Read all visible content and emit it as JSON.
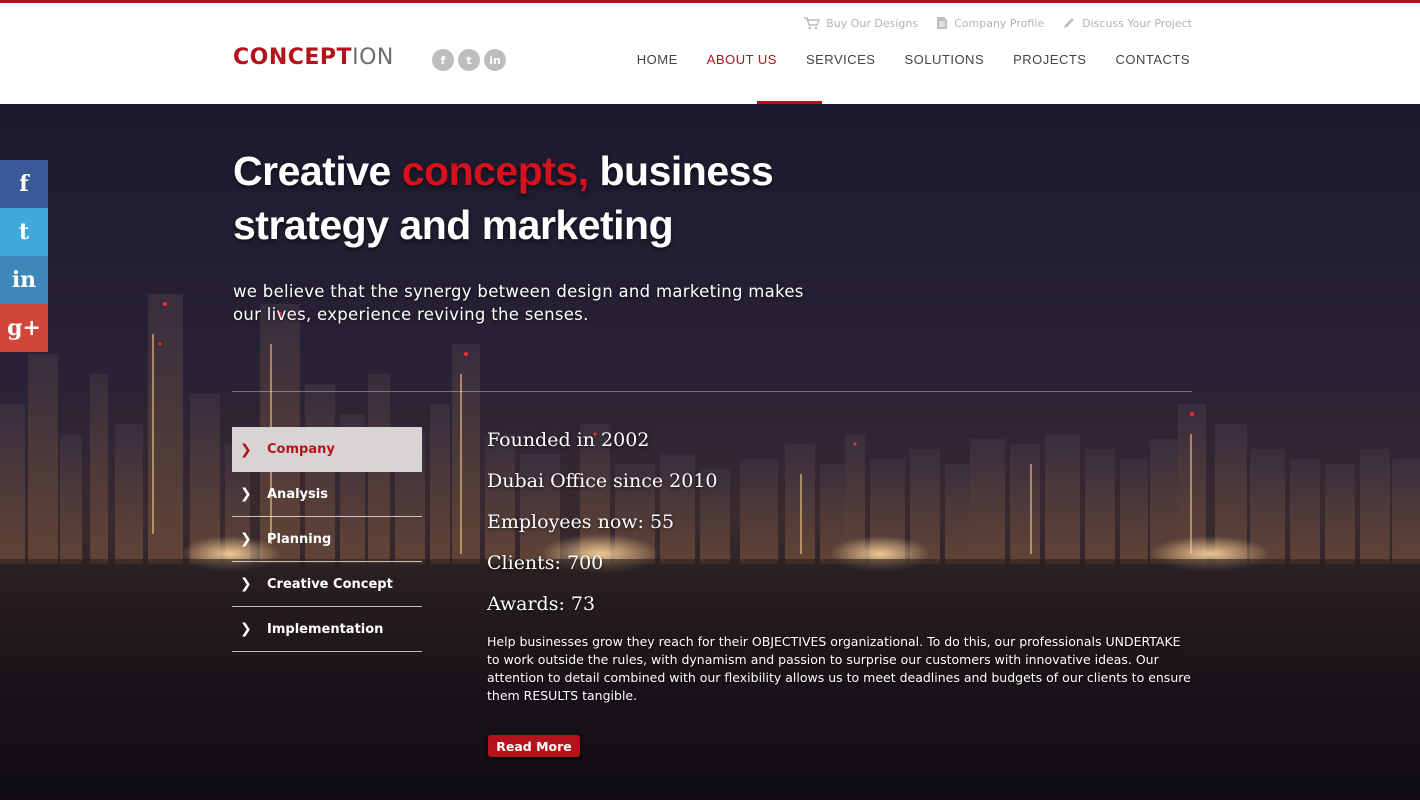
{
  "header": {
    "utility_links": [
      {
        "label": "Buy Our Designs",
        "icon": "cart-icon"
      },
      {
        "label": "Company Profile",
        "icon": "document-icon"
      },
      {
        "label": "Discuss Your Project",
        "icon": "pencil-icon"
      }
    ],
    "logo": {
      "part1": "CONCEPT",
      "part2": "ION"
    },
    "social_icons": [
      "facebook-icon",
      "twitter-icon",
      "linkedin-icon"
    ],
    "nav": [
      "HOME",
      "ABOUT US",
      "SERVICES",
      "SOLUTIONS",
      "PROJECTS",
      "CONTACTS"
    ],
    "active_nav": "ABOUT US"
  },
  "side_social": [
    {
      "label": "f",
      "icon": "facebook-icon",
      "color": "#3b5998"
    },
    {
      "label": "t",
      "icon": "twitter-icon",
      "color": "#3fa9d9"
    },
    {
      "label": "in",
      "icon": "linkedin-icon",
      "color": "#3d88b8"
    },
    {
      "label": "g+",
      "icon": "google-plus-icon",
      "color": "#d0473a"
    }
  ],
  "hero": {
    "headline_part1": "Creative ",
    "headline_highlight": "concepts,",
    "headline_part2": " business strategy and marketing",
    "tagline": "we believe that the synergy between design and marketing makes our lives, experience reviving the senses."
  },
  "tabs": [
    "Company",
    "Analysis",
    "Planning",
    "Creative Concept",
    "Implementation"
  ],
  "active_tab": "Company",
  "facts": [
    "Founded in 2002",
    "Dubai Office since 2010",
    "Employees now: 55",
    "Clients: 700",
    "Awards: 73"
  ],
  "description": "Help businesses grow they reach for their OBJECTIVES organizational. To do this, our professionals UNDERTAKE to work outside the rules, with dynamism and passion to surprise our customers with innovative ideas. Our attention to detail combined with our flexibility allows us to meet deadlines and budgets of our clients to ensure them RESULTS tangible.",
  "read_more": "Read More",
  "colors": {
    "accent": "#b5121b",
    "highlight": "#d4121e"
  }
}
